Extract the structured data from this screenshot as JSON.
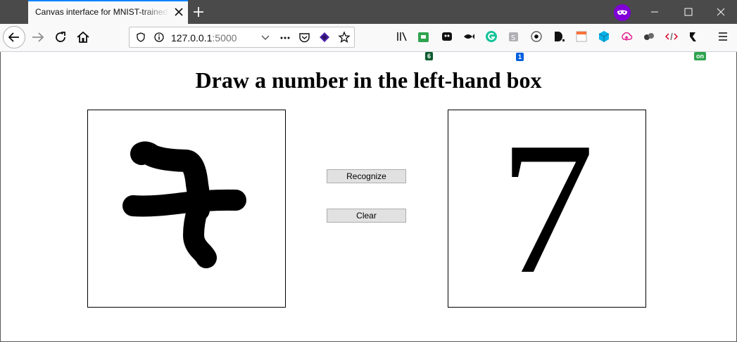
{
  "browser": {
    "tab": {
      "title": "Canvas interface for MNIST-trained"
    },
    "url": {
      "host": "127.0.0.1",
      "port": ":5000"
    },
    "toolbar_badges": {
      "extension_a": "6",
      "extension_b": "1",
      "extension_c": "on"
    }
  },
  "page": {
    "heading": "Draw a number in the left-hand box",
    "buttons": {
      "recognize": "Recognize",
      "clear": "Clear"
    },
    "result": {
      "digit": "7"
    }
  },
  "colors": {
    "tab_strip": "#4a4a4a",
    "tab_accent": "#0a84ff",
    "button_bg": "#e1e1e1",
    "private_badge": "#8000d7"
  }
}
